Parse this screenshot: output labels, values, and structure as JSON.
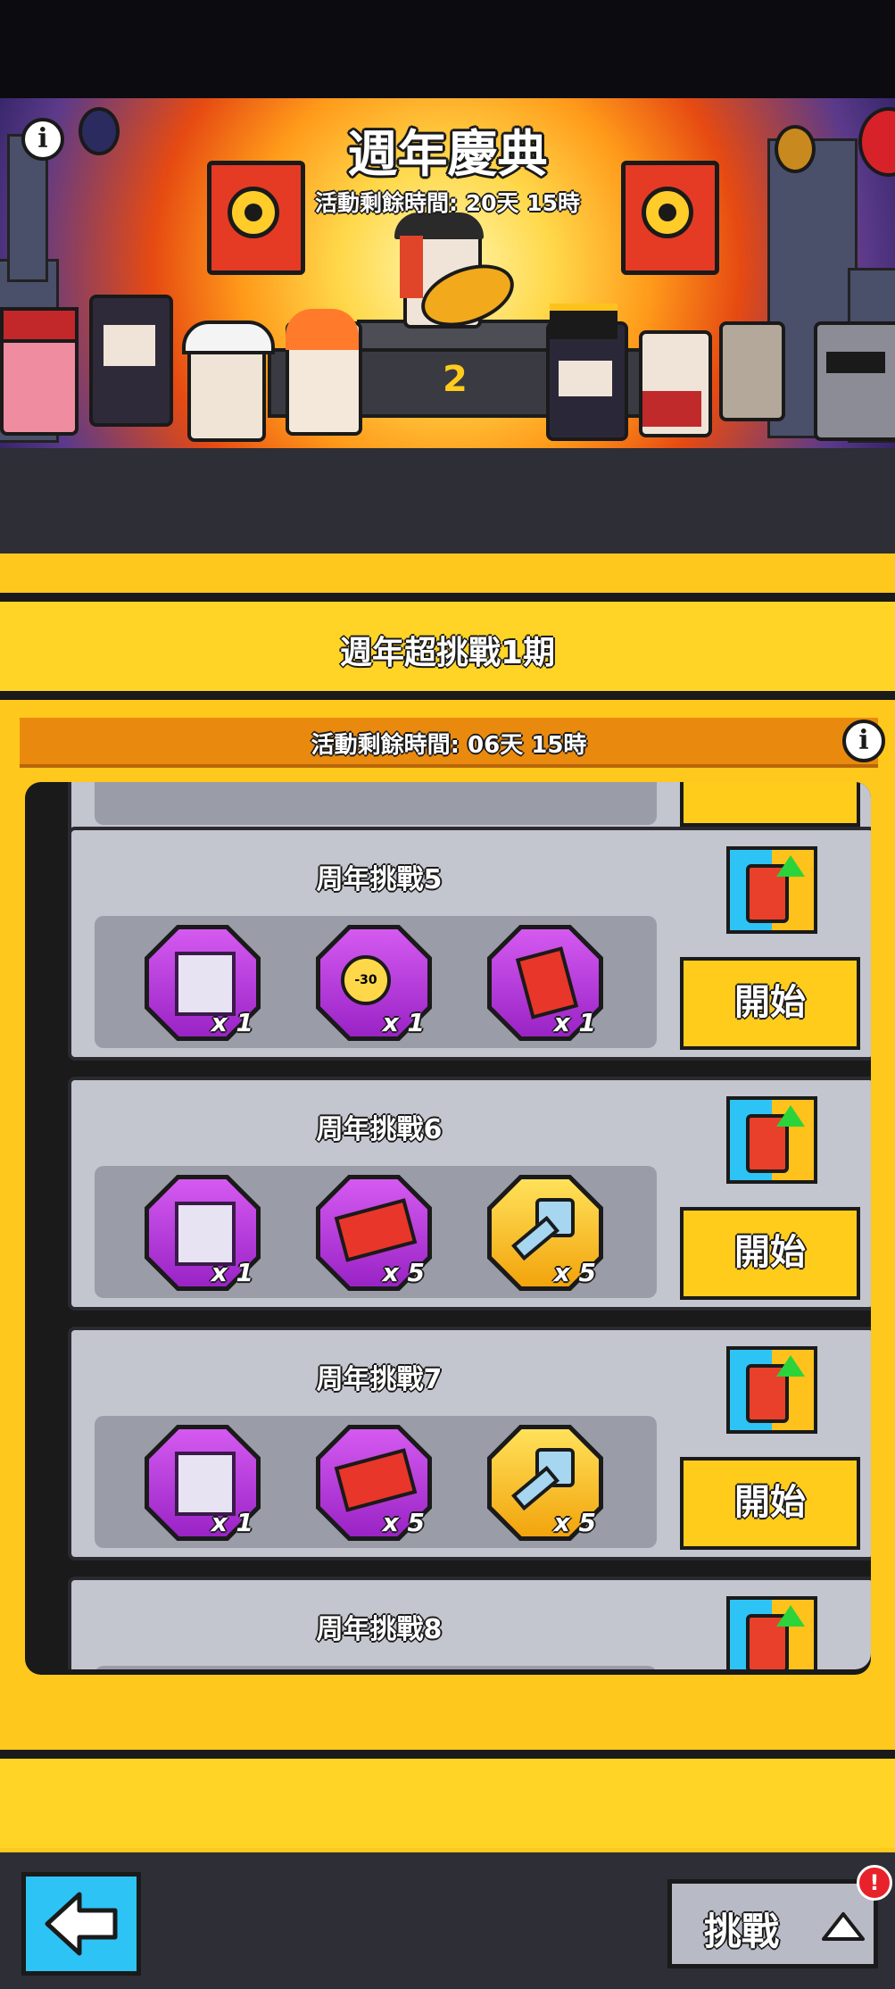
{
  "event": {
    "title": "週年慶典",
    "timer": "活動剩餘時間: 20天 15時",
    "stage_number": "2"
  },
  "panel": {
    "title": "週年超挑戰1期",
    "timer": "活動剩餘時間: 06天 15時"
  },
  "challenges": [
    {
      "title": "周年挑戰5",
      "button": "開始",
      "rewards": [
        {
          "icon": "chest-icon",
          "color": "purple",
          "qty": "x 1"
        },
        {
          "icon": "speedup-ticket-icon",
          "color": "purple",
          "badge": "-30",
          "qty": "x 1"
        },
        {
          "icon": "card-pack-icon",
          "color": "purple",
          "qty": "x 1"
        }
      ]
    },
    {
      "title": "周年挑戰6",
      "button": "開始",
      "rewards": [
        {
          "icon": "chest-icon",
          "color": "purple",
          "qty": "x 1"
        },
        {
          "icon": "crown-ticket-icon",
          "color": "purple",
          "qty": "x 5"
        },
        {
          "icon": "key-icon",
          "color": "gold",
          "qty": "x 5"
        }
      ]
    },
    {
      "title": "周年挑戰7",
      "button": "開始",
      "rewards": [
        {
          "icon": "chest-icon",
          "color": "purple",
          "qty": "x 1"
        },
        {
          "icon": "crown-ticket-icon",
          "color": "purple",
          "qty": "x 5"
        },
        {
          "icon": "key-icon",
          "color": "gold",
          "qty": "x 5"
        }
      ]
    },
    {
      "title": "周年挑戰8"
    }
  ],
  "bottom_bar": {
    "back_icon": "arrow-left-icon",
    "challenge_label": "挑戰",
    "challenge_icon": "triangle-up-icon",
    "alert_badge": "!"
  },
  "colors": {
    "frame_yellow": "#ffc81c",
    "button_yellow": "#ffcc1c",
    "timer_orange": "#e98a0e",
    "reward_purple": "#b13ed9",
    "back_button_blue": "#2ec3f5"
  }
}
